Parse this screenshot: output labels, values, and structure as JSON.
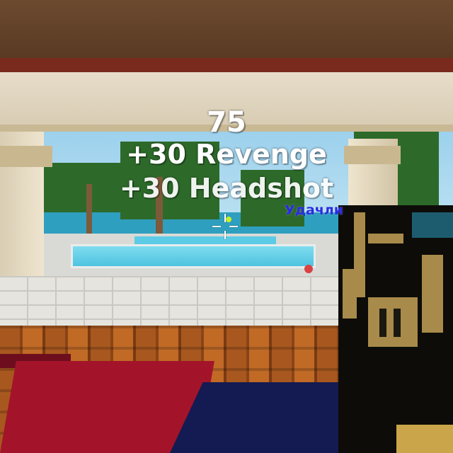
{
  "hud": {
    "kill_points": "75",
    "bonus_revenge": "+30 Revenge",
    "bonus_headshot": "+30 Headshot",
    "enemy_nickname": "Удачли"
  },
  "colors": {
    "hud_text": "#ffffff",
    "enemy_name": "#2a2ce0"
  },
  "icons": {
    "crosshair": "crosshair-icon"
  }
}
